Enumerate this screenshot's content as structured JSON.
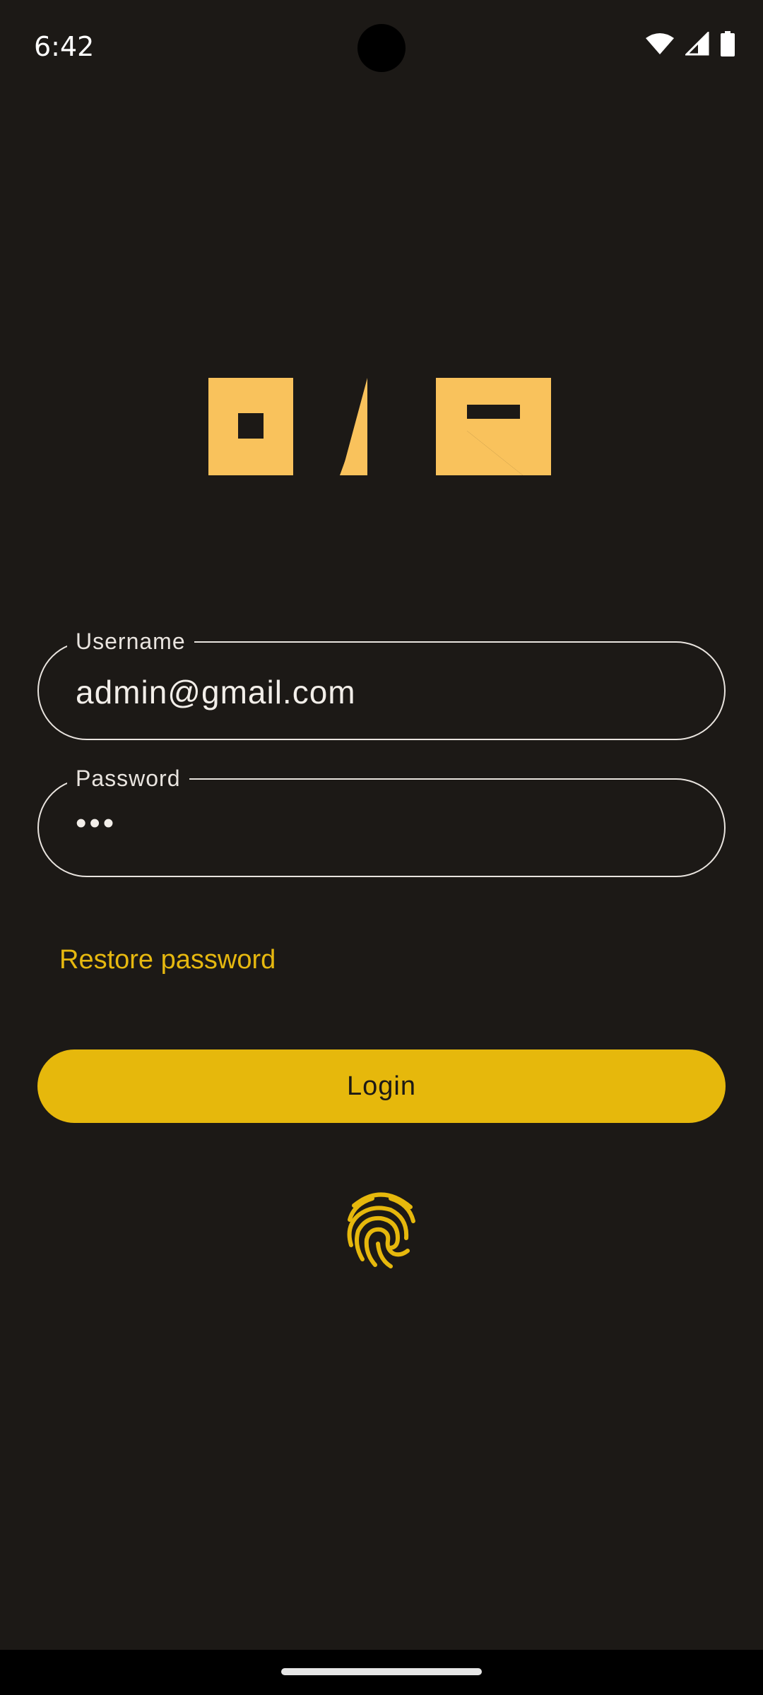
{
  "status_bar": {
    "time": "6:42",
    "icons": [
      "wifi-icon",
      "signal-icon",
      "battery-icon"
    ]
  },
  "logo": {
    "alt": "ONR"
  },
  "form": {
    "username": {
      "label": "Username",
      "value": "admin@gmail.com"
    },
    "password": {
      "label": "Password",
      "value": "•••"
    },
    "restore_label": "Restore password",
    "login_label": "Login",
    "biometric_icon": "fingerprint-icon"
  },
  "colors": {
    "background": "#1c1916",
    "accent": "#e6b80c",
    "logo": "#f9c25c",
    "outline": "#e9e4df"
  }
}
